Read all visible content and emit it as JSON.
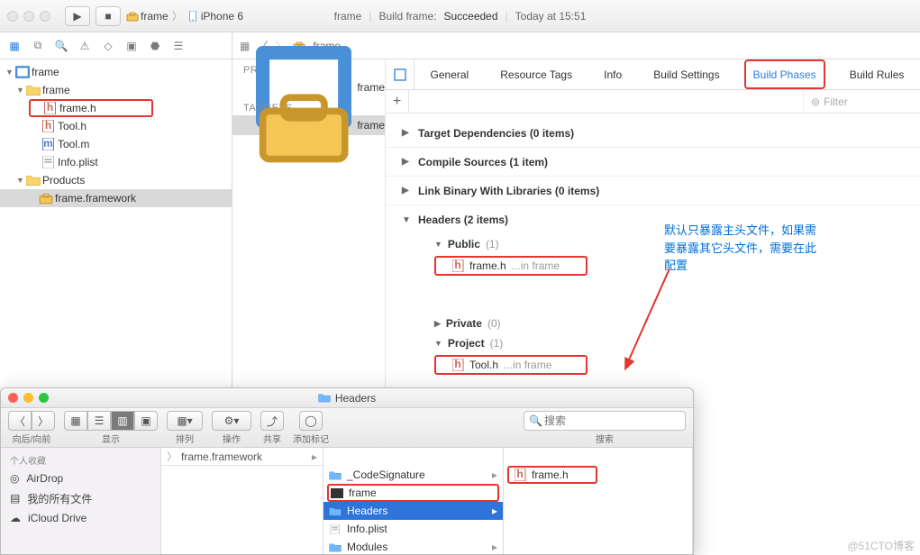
{
  "topbar": {
    "breadcrumb": {
      "item1": "frame",
      "item2": "iPhone 6"
    },
    "status": {
      "project": "frame",
      "build_label": "Build frame:",
      "build_result": "Succeeded",
      "time": "Today at 15:51"
    }
  },
  "jumpbar": {
    "path": "frame"
  },
  "navigator": {
    "root": "frame",
    "group1": "frame",
    "file_frame_h": "frame.h",
    "file_tool_h": "Tool.h",
    "file_tool_m": "Tool.m",
    "file_info_plist": "Info.plist",
    "group_products": "Products",
    "product_framework": "frame.framework"
  },
  "midcol": {
    "project_hdr": "PROJECT",
    "project_name": "frame",
    "targets_hdr": "TARGETS",
    "target_name": "frame"
  },
  "tabs": {
    "general": "General",
    "resource_tags": "Resource Tags",
    "info": "Info",
    "build_settings": "Build Settings",
    "build_phases": "Build Phases",
    "build_rules": "Build Rules"
  },
  "filter_placeholder": "Filter",
  "phases": {
    "target_deps": "Target Dependencies (0 items)",
    "compile_sources": "Compile Sources (1 item)",
    "link_binary": "Link Binary With Libraries (0 items)",
    "headers": "Headers (2 items)",
    "public_hdr": "Public",
    "public_cnt": "(1)",
    "public_file": "frame.h",
    "public_suffix": "...in frame",
    "private_hdr": "Private",
    "private_cnt": "(0)",
    "project_hdr": "Project",
    "project_cnt": "(1)",
    "project_file": "Tool.h",
    "project_suffix": "...in frame"
  },
  "annotation": "默认只暴露主头文件，如果需要暴露其它头文件，需要在此配置",
  "finder": {
    "title": "Headers",
    "labels": {
      "nav": "向后/向前",
      "view": "显示",
      "arrange": "排列",
      "action": "操作",
      "share": "共享",
      "tags": "添加标记",
      "search": "搜索"
    },
    "search_placeholder": "搜索",
    "sidebar": {
      "hdr": "个人收藏",
      "airdrop": "AirDrop",
      "allfiles": "我的所有文件",
      "icloud": "iCloud Drive"
    },
    "col1": {
      "path": "frame.framework"
    },
    "col2": {
      "code_sig": "_CodeSignature",
      "frame": "frame",
      "headers": "Headers",
      "info_plist": "Info.plist",
      "modules": "Modules"
    },
    "col3": {
      "frame_h": "frame.h"
    }
  },
  "watermark": "@51CTO博客"
}
